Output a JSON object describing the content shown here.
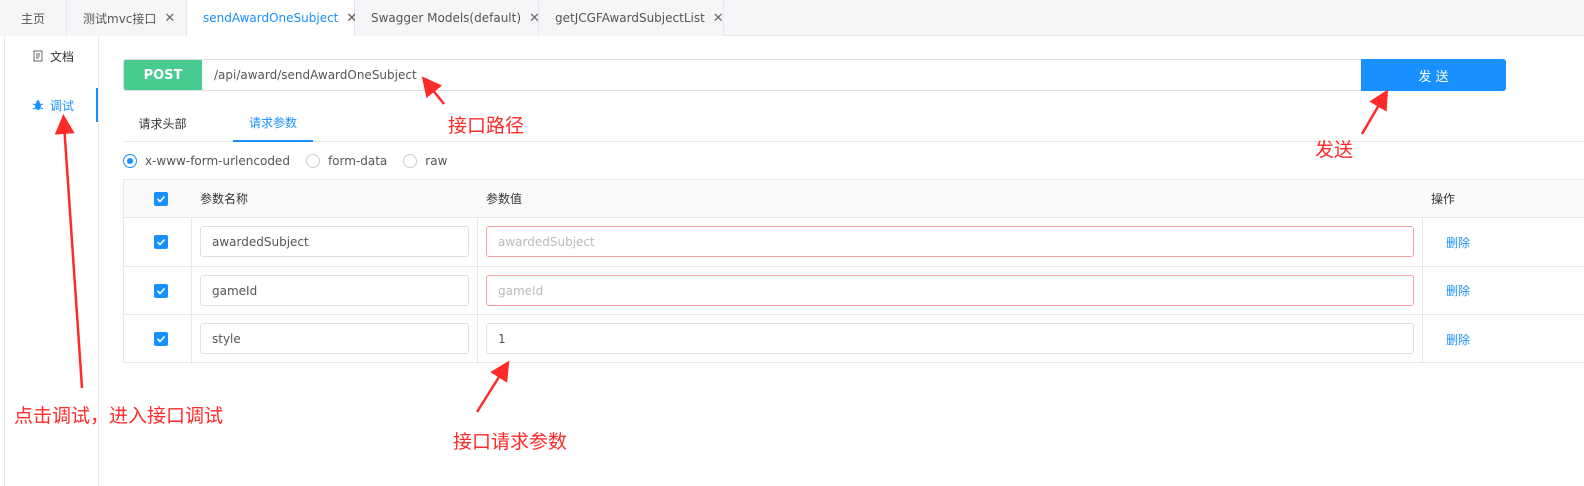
{
  "tabs": [
    {
      "label": "主页",
      "closable": false
    },
    {
      "label": "测试mvc接口",
      "closable": true
    },
    {
      "label": "sendAwardOneSubject",
      "closable": true,
      "active": true
    },
    {
      "label": "Swagger Models(default)",
      "closable": true
    },
    {
      "label": "getJCGFAwardSubjectList",
      "closable": true
    }
  ],
  "tab_close_glyph": "✕",
  "sidebar": {
    "items": [
      {
        "label": "文档",
        "icon": "document-icon"
      },
      {
        "label": "调试",
        "icon": "bug-icon",
        "active": true
      }
    ]
  },
  "request": {
    "method": "POST",
    "url": "/api/award/sendAwardOneSubject",
    "send_label": "发 送"
  },
  "subtabs": [
    {
      "label": "请求头部"
    },
    {
      "label": "请求参数",
      "active": true
    }
  ],
  "body_types": [
    {
      "label": "x-www-form-urlencoded",
      "checked": true
    },
    {
      "label": "form-data",
      "checked": false
    },
    {
      "label": "raw",
      "checked": false
    }
  ],
  "params_table": {
    "headers": {
      "name": "参数名称",
      "value": "参数值",
      "action": "操作"
    },
    "rows": [
      {
        "checked": true,
        "name": "awardedSubject",
        "value": "",
        "value_placeholder": "awardedSubject",
        "invalid": true,
        "action": "删除"
      },
      {
        "checked": true,
        "name": "gameId",
        "value": "",
        "value_placeholder": "gameId",
        "invalid": true,
        "action": "删除"
      },
      {
        "checked": true,
        "name": "style",
        "value": "1",
        "value_placeholder": "",
        "invalid": false,
        "action": "删除"
      }
    ]
  },
  "annotations": {
    "url_path": "接口路径",
    "send": "发送",
    "debug": "点击调试，进入接口调试",
    "params": "接口请求参数"
  },
  "colors": {
    "accent": "#1890ff",
    "post_method": "#49cc90",
    "annotation": "#ff2a2a",
    "invalid_border": "#f3a3a3"
  }
}
